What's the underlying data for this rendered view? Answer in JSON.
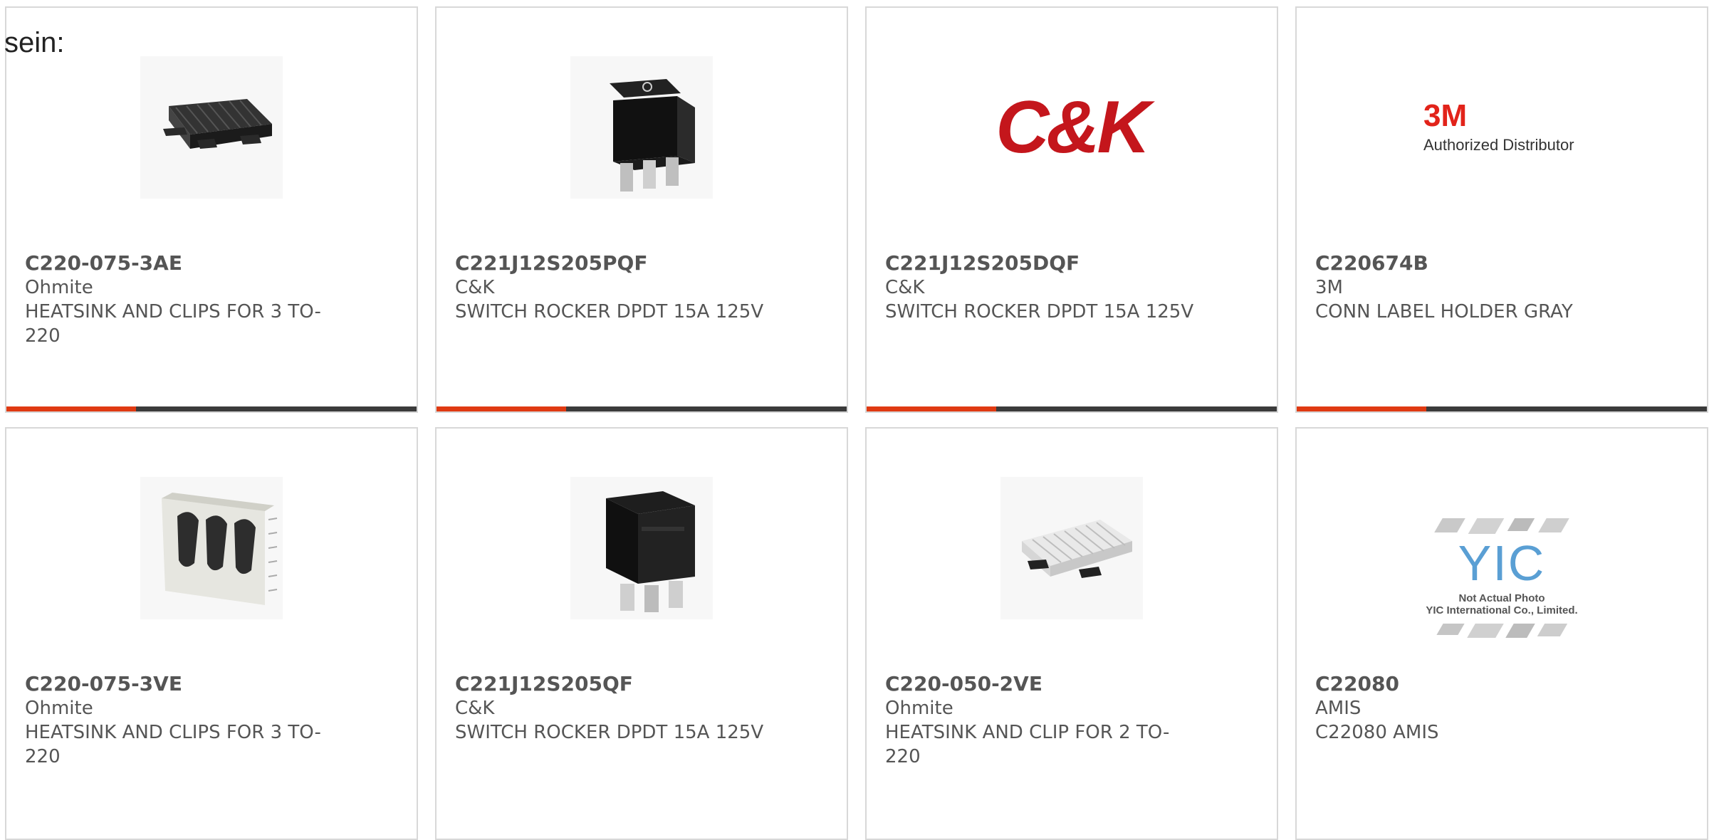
{
  "intro_text": "sein:",
  "colors": {
    "accent": "#e03a12",
    "bar": "#3b3b3b",
    "border": "#d8d8d8",
    "text": "#555555"
  },
  "products": [
    {
      "part": "C220-075-3AE",
      "maker": "Ohmite",
      "desc": "HEATSINK AND CLIPS FOR 3 TO-220",
      "image": "heatsink-3clip-black-icon"
    },
    {
      "part": "C221J12S205PQF",
      "maker": "C&K",
      "desc": "SWITCH ROCKER DPDT 15A 125V",
      "image": "rocker-switch-icon"
    },
    {
      "part": "C221J12S205DQF",
      "maker": "C&K",
      "desc": "SWITCH ROCKER DPDT 15A 125V",
      "image": "ck-logo",
      "logo_text": "C&K"
    },
    {
      "part": "C220674B",
      "maker": "3M",
      "desc": "CONN LABEL HOLDER GRAY",
      "image": "3m-logo",
      "logo_text": "3M",
      "logo_sub": "Authorized Distributor"
    },
    {
      "part": "C220-075-3VE",
      "maker": "Ohmite",
      "desc": "HEATSINK AND CLIPS FOR 3 TO-220",
      "image": "heatsink-3clip-silver-icon"
    },
    {
      "part": "C221J12S205QF",
      "maker": "C&K",
      "desc": "SWITCH ROCKER DPDT 15A 125V",
      "image": "rocker-switch-icon"
    },
    {
      "part": "C220-050-2VE",
      "maker": "Ohmite",
      "desc": "HEATSINK AND CLIP FOR 2 TO-220",
      "image": "heatsink-2clip-silver-icon"
    },
    {
      "part": "C22080",
      "maker": "AMIS",
      "desc": "C22080 AMIS",
      "image": "yic-placeholder",
      "logo_text": "YIC",
      "logo_sub": "Not Actual Photo",
      "logo_sub2": "YIC International Co., Limited."
    }
  ]
}
